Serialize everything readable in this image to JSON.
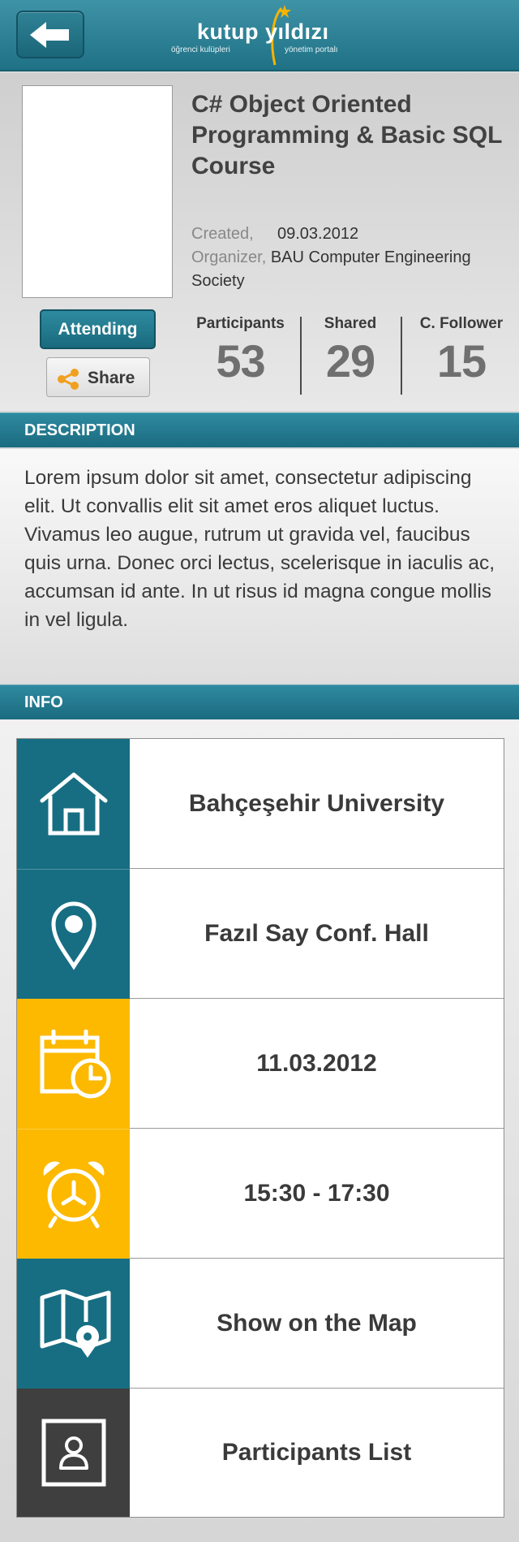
{
  "header": {
    "logo_main": "kutup yıldızı",
    "logo_sub_left": "öğrenci kulüpleri",
    "logo_sub_right": "yönetim portalı",
    "back_icon": "back-arrow-icon"
  },
  "event": {
    "title": "C# Object Oriented Programming & Basic SQL Course",
    "created_label": "Created,",
    "created_value": "09.03.2012",
    "organizer_label": "Organizer,",
    "organizer_value": "BAU Computer Engineering Society",
    "attending_label": "Attending",
    "share_label": "Share"
  },
  "stats": [
    {
      "label": "Participants",
      "value": "53"
    },
    {
      "label": "Shared",
      "value": "29"
    },
    {
      "label": "C. Follower",
      "value": "15"
    }
  ],
  "description": {
    "heading": "DESCRIPTION",
    "text": "Lorem ipsum dolor sit amet, consectetur adipiscing elit. Ut convallis elit sit amet eros aliquet luctus. Vivamus leo augue, rutrum ut gravida vel, faucibus quis urna. Donec orci lectus, scelerisque in iaculis ac, accumsan id ante. In ut risus id magna congue mollis in vel ligula."
  },
  "info": {
    "heading": "INFO",
    "rows": [
      {
        "icon": "home-icon",
        "text": "Bahçeşehir University",
        "color": "#176e82"
      },
      {
        "icon": "location-pin-icon",
        "text": "Fazıl Say Conf. Hall",
        "color": "#176e82"
      },
      {
        "icon": "calendar-clock-icon",
        "text": "11.03.2012",
        "color": "#fcb900"
      },
      {
        "icon": "alarm-clock-icon",
        "text": "15:30 - 17:30",
        "color": "#fcb900"
      },
      {
        "icon": "map-icon",
        "text": "Show on the Map",
        "color": "#176e82"
      },
      {
        "icon": "participants-list-icon",
        "text": "Participants List",
        "color": "#3f3f3f"
      }
    ]
  },
  "colors": {
    "accent_teal": "#1f7186",
    "accent_yellow": "#fcb900",
    "dark": "#3f3f3f"
  }
}
